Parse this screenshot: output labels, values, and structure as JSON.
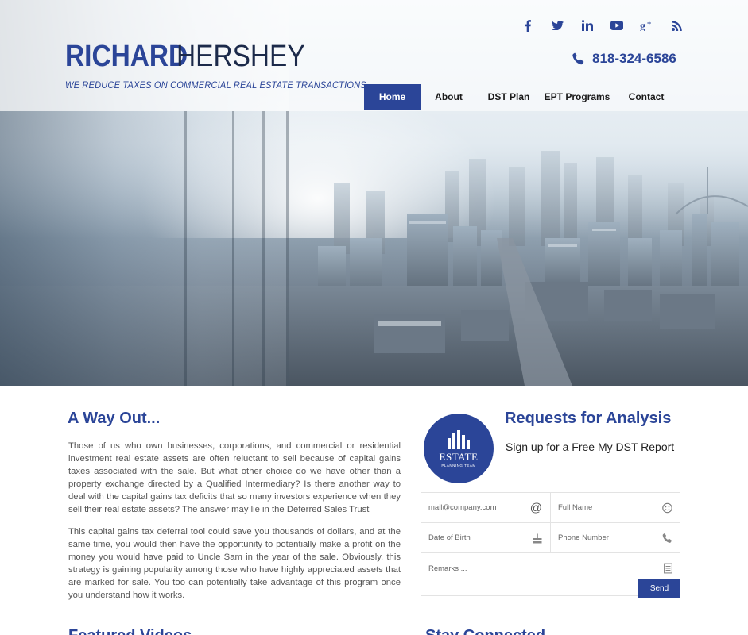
{
  "brand": {
    "first": "RICHARD",
    "last": "HERSHEY",
    "tagline": "WE REDUCE TAXES ON COMMERCIAL REAL ESTATE TRANSACTIONS"
  },
  "social": [
    "facebook-icon",
    "twitter-icon",
    "linkedin-icon",
    "youtube-icon",
    "google-plus-icon",
    "rss-icon"
  ],
  "phone": "818-324-6586",
  "nav": [
    {
      "label": "Home",
      "active": true
    },
    {
      "label": "About"
    },
    {
      "label": "DST Plan"
    },
    {
      "label": "EPT Programs"
    },
    {
      "label": "Contact"
    }
  ],
  "intro": {
    "title": "A Way Out...",
    "p1": "Those of us who own businesses, corporations, and commercial or residential investment real estate assets are often reluctant to sell because of capital gains taxes associated with the sale. But what other choice do we have other than a property exchange directed by a Qualified Intermediary? Is there another way to deal with the capital gains tax deficits that so many investors experience when they sell their real estate assets? The answer may lie in the Deferred Sales Trust",
    "p2": "This capital gains tax deferral tool could save you thousands of dollars, and at the same time, you would then have the opportunity to potentially make a profit on the money you would have paid to Uncle Sam in the year of the sale. Obviously, this strategy is gaining popularity among those who have highly appreciated assets that are marked for sale. You too can potentially take advantage of this program once you understand how it works."
  },
  "logo": {
    "word": "ESTATE",
    "sub": "PLANNING TEAM"
  },
  "request": {
    "title": "Requests for Analysis",
    "subtitle": "Sign up for a Free My DST Report",
    "email_placeholder": "mail@company.com",
    "name_placeholder": "Full Name",
    "dob_placeholder": "Date of Birth",
    "phone_placeholder": "Phone Number",
    "remarks_placeholder": "Remarks ...",
    "send_label": "Send"
  },
  "bottom": {
    "left_title": "Featured Videos",
    "right_title": "Stay Connected"
  },
  "colors": {
    "brand": "#2b4598",
    "brand_dark": "#1c2a4a"
  }
}
